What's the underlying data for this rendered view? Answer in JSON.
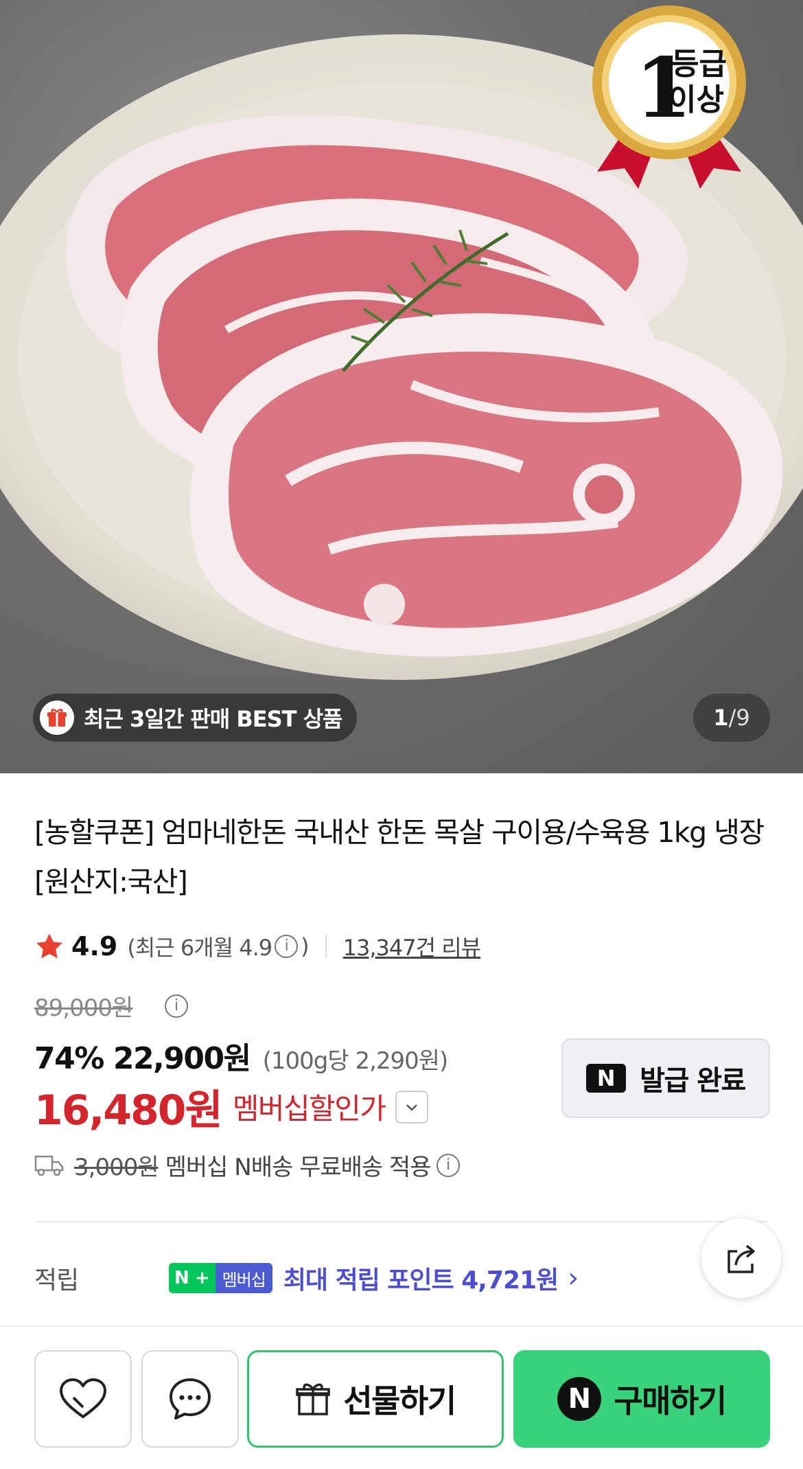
{
  "gallery": {
    "badge_line1": "1",
    "badge_line2": "등급",
    "badge_line3": "이상",
    "best_label": "최근 3일간 판매 BEST 상품",
    "current_index": "1",
    "total_label": "/9",
    "colors": {
      "meat": "#d9707a",
      "fat": "#f6ecee",
      "plate": "#e6e3d8"
    }
  },
  "product": {
    "title": "[농할쿠폰] 엄마네한돈 국내산 한돈 목살 구이용/수육용 1kg 냉장 [원산지:국산]",
    "rating": "4.9",
    "recent_prefix": "(최근 6개월 4.9",
    "info_glyph": "i",
    "recent_suffix": ")",
    "review_count": "13,347건 리뷰",
    "original_price": "89,000원",
    "discount_rate": "74%",
    "sale_price": "22,900원",
    "unit_price": "(100g당 2,290원)",
    "member_price": "16,480원",
    "member_label": "멤버십할인가",
    "star_color": "#e8412e",
    "member_color": "#d5242c"
  },
  "coupon": {
    "logo": "N",
    "label": "발급 완료"
  },
  "shipping": {
    "old_fee": "3,000원",
    "text": "멤버십 N배송 무료배송 적용"
  },
  "points": {
    "label": "적립",
    "badge_n": "N",
    "badge_plus": "+",
    "badge_member": "멤버십",
    "text": "최대 적립 포인트 4,721원",
    "chevron": "›",
    "color": "#4b4ed0"
  },
  "bottom_bar": {
    "gift_label": "선물하기",
    "buy_logo": "N",
    "buy_label": "구매하기",
    "buy_color": "#38d27a"
  }
}
